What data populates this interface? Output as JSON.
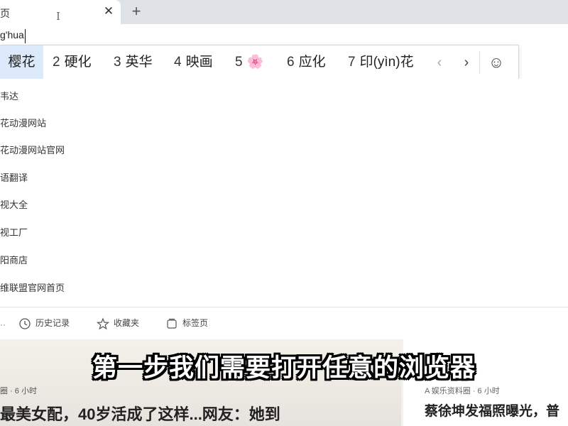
{
  "browser": {
    "tab_title": "页",
    "tab_close": "✕",
    "new_tab": "+"
  },
  "address_bar": {
    "value": "g'hua"
  },
  "ime": {
    "candidates": [
      {
        "num": "",
        "text": "樱花"
      },
      {
        "num": "2",
        "text": "硬化"
      },
      {
        "num": "3",
        "text": "英华"
      },
      {
        "num": "4",
        "text": "映画"
      },
      {
        "num": "5",
        "text": "🌸"
      },
      {
        "num": "6",
        "text": "应化"
      },
      {
        "num": "7",
        "text": "印(yìn)花"
      }
    ],
    "prev": "‹",
    "next": "›",
    "emoji": "☺"
  },
  "suggestions": [
    "韦达",
    "花动漫网站",
    "花动漫网站官网",
    "语翻译",
    "视大全",
    "视工厂",
    "阳商店",
    "维联盟官网首页"
  ],
  "shortcuts": {
    "history": "历史记录",
    "favorites": "收藏夹",
    "tabs": "标签页"
  },
  "news": {
    "left_meta": "圈 · 6 小时",
    "left_headline": "最美女配，40岁活成了这样...网友：她到",
    "right_meta": "A  娱乐资料圈 · 6 小时",
    "right_headline": "蔡徐坤发福照曝光，普"
  },
  "caption": "第一步我们需要打开任意的浏览器"
}
